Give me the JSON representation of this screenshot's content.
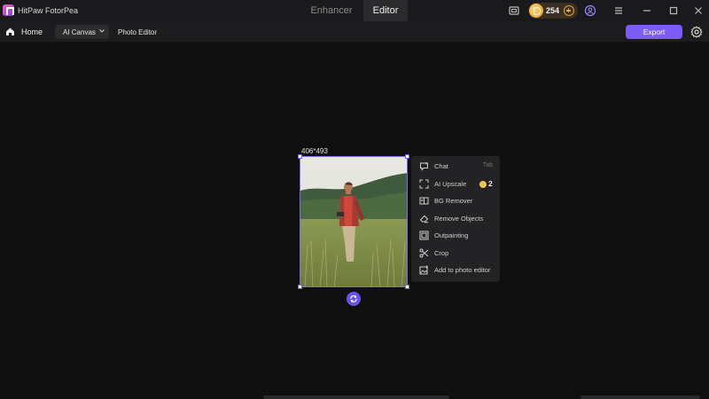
{
  "app": {
    "title": "HitPaw FotorPea"
  },
  "mode_tabs": [
    {
      "label": "Enhancer",
      "active": false
    },
    {
      "label": "Editor",
      "active": true
    }
  ],
  "titlebar": {
    "credits": "254",
    "icons": [
      "monitor-icon",
      "coin-icon",
      "add-credits-icon",
      "account-icon",
      "menu-icon",
      "minimize-icon",
      "maximize-icon",
      "close-icon"
    ]
  },
  "toolbar": {
    "home_label": "Home",
    "canvas_dropdown": "AI Canvas",
    "photo_editor_label": "Photo Editor",
    "export_label": "Export"
  },
  "canvas": {
    "image_dimensions": "406*493"
  },
  "context_menu": {
    "items": [
      {
        "label": "Chat",
        "shortcut": "Tab",
        "icon": "chat-icon"
      },
      {
        "label": "AI Upscale",
        "credit_cost": "2",
        "icon": "upscale-icon"
      },
      {
        "label": "BG Remover",
        "icon": "bg-remover-icon"
      },
      {
        "label": "Remove Objects",
        "icon": "eraser-icon"
      },
      {
        "label": "Outpainting",
        "icon": "outpainting-icon"
      },
      {
        "label": "Crop",
        "icon": "scissors-icon"
      },
      {
        "label": "Add to photo editor",
        "icon": "add-image-icon"
      }
    ]
  },
  "colors": {
    "accent": "#7b5cf5",
    "background": "#0f0f10",
    "titlebar": "#1a1a1c",
    "coin": "#e39a2b"
  }
}
